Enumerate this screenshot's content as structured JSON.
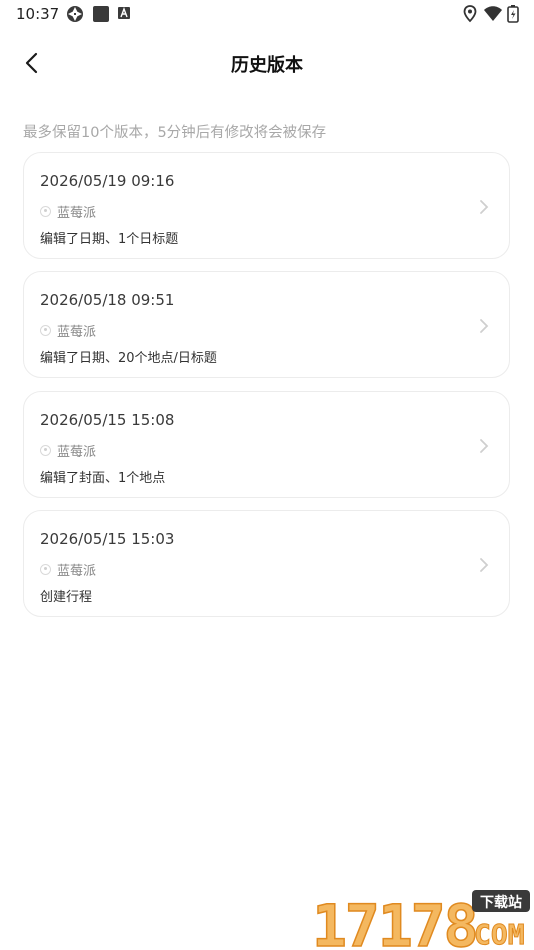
{
  "status_bar": {
    "time": "10:37",
    "left_icons": [
      "aperture-icon",
      "square-app-icon",
      "android-a-icon"
    ],
    "right_icons": [
      "location-icon",
      "wifi-icon",
      "battery-icon"
    ]
  },
  "header": {
    "title": "历史版本",
    "back_icon": "chevron-left-icon"
  },
  "hint": "最多保留10个版本，5分钟后有修改将会被保存",
  "versions": [
    {
      "datetime": "2026/05/19 09:16",
      "user": "蓝莓派",
      "description": "编辑了日期、1个日标题"
    },
    {
      "datetime": "2026/05/18 09:51",
      "user": "蓝莓派",
      "description": "编辑了日期、20个地点/日标题"
    },
    {
      "datetime": "2026/05/15 15:08",
      "user": "蓝莓派",
      "description": "编辑了封面、1个地点"
    },
    {
      "datetime": "2026/05/15 15:03",
      "user": "蓝莓派",
      "description": "创建行程"
    }
  ],
  "watermark": {
    "number": "17178",
    "tag": "下载站",
    "domain": "COM"
  },
  "colors": {
    "background": "#ffffff",
    "card_border": "#ececec",
    "hint_text": "#a8a8a8",
    "watermark_orange": "#f0a030"
  }
}
